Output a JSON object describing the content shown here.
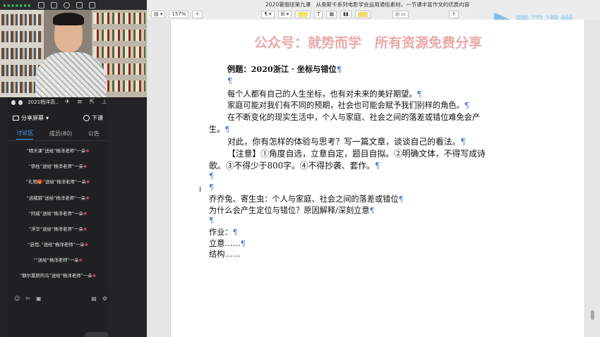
{
  "class_panel": {
    "title": "2021杨洋高…",
    "share_label": "分享屏幕",
    "leave_label": "下课",
    "tabs": [
      {
        "label": "讨论区",
        "active": true
      },
      {
        "label": "成员(80)",
        "active": false
      },
      {
        "label": "公告",
        "active": false
      }
    ],
    "chat": [
      "“晴天课”送给“杨洋老师”一朵",
      "“铁柱”送给“杨洋老师”一朵",
      "“礼物🎁”送给“杨洋老师”一朵",
      "“卤猪蹄”送给“杨洋老师”一朵",
      "“阿威”送给“杨洋老师”一朵",
      "“浮华”送给“杨洋老师”一朵",
      "“启恒、”送给“杨洋老师”一朵",
      "“”送给“杨洋老师”一朵",
      "“赫尔莫斯的鸟”送给“杨洋老师”一朵"
    ],
    "flower_glyph": "❀",
    "flower_color": "#ff4d6d",
    "accent_color": "#4aa3ff"
  },
  "editor": {
    "doc_title": "2020暑假班第九课　从奥斯卡系列电影学会运用通俗素材，一节课丰富作文的优质内容",
    "zoom": "157%",
    "watermark_logo_text": "腾讯课堂",
    "doc_watermark": "公众号：就势而学　所有资源免费分享",
    "pilcrow": "¶",
    "lines": [
      "例题：2020浙江 · 坐标与错位",
      "",
      "每个人都有自己的人生坐标，也有对未来的美好期望。",
      "家庭可能对我们有不同的预期，社会也可能会赋予我们别样的角色。",
      "在不断变化的现实生活中，个人与家庭、社会之间的落差或错位难免会产",
      "生。",
      "对此，你有怎样的体验与思考？写一篇文章，谈谈自己的看法。",
      "【注意】①角度自选，立意自定，题目自拟。②明确文体，不得写成诗",
      "歌。③不得少于800字。④不得抄袭、套作。",
      "",
      "",
      "乔乔兔、寄生虫：个人与家庭、社会之间的落差或错位",
      "为什么会产生定位与错位？原因解释/深刻立意",
      "",
      "作业：",
      "立意……",
      "结构……"
    ]
  }
}
